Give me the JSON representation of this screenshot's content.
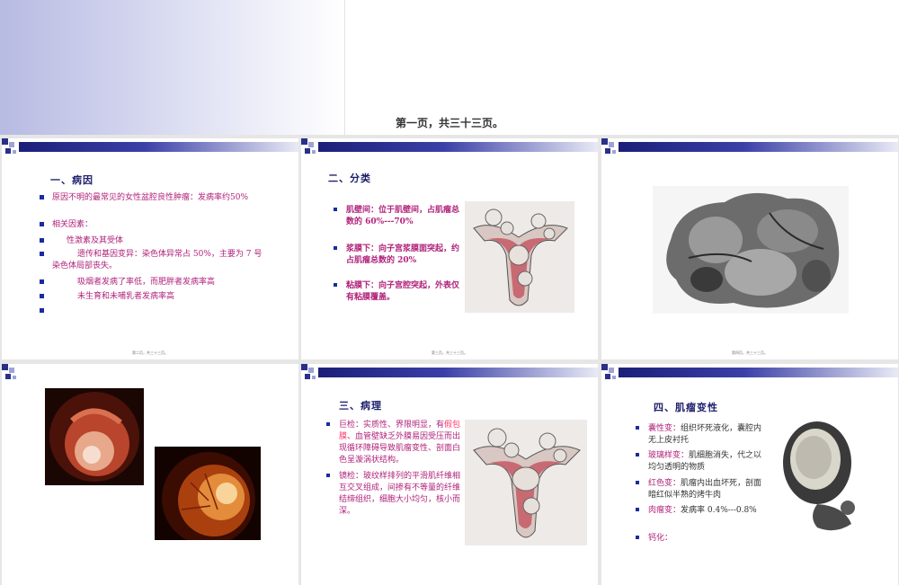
{
  "top": {
    "footer": "第一页，共三十三页。"
  },
  "slides": [
    {
      "title": "一、病因",
      "bullets": [
        "原因不明的最常见的女性盆腔良性肿瘤：发病率约50%",
        "相关因素：",
        "性激素及其受体",
        "遗传和基因变异：染色体异常占 50%，主要为 7 号染色体局部丧失。",
        "吸烟者发病了率低，而肥胖者发病率高",
        "未生育和未哺乳者发病率高",
        ""
      ],
      "footer": "第二页，共三十三页。"
    },
    {
      "title": "二、分类",
      "bullets": [
        "肌壁间：位于肌壁间，占肌瘤总数的 60%---70%",
        "浆膜下：向子宫浆膜面突起，约占肌瘤总数的 20%",
        "粘膜下：向子宫腔突起，外表仅有粘膜覆盖。"
      ],
      "footer": "第三页，共三十三页。"
    },
    {
      "footer": "第四页，共三十三页。"
    },
    {
      "footer": ""
    },
    {
      "title": "三、病理",
      "bullets": [
        {
          "pre": "巨检：实质性、界限明显，有",
          "hl": "假包膜",
          "post": "、血管壁缺乏外膜易因受压而出现循环障碍导致肌瘤变性、剖面白色呈漩涡状结构。"
        },
        {
          "pre": "镜检：玻纹样排列的平滑肌纤维相互交叉组成，间掺有不等量的纤维结缔组织，细胞大小均匀，核小而深。",
          "hl": "",
          "post": ""
        }
      ],
      "footer": ""
    },
    {
      "title": "四、肌瘤变性",
      "bullets": [
        {
          "lead": "囊性变：",
          "text": "组织坏死液化，囊腔内无上皮衬托"
        },
        {
          "lead": "玻璃样变：",
          "text": "肌细胞消失，代之以均匀透明的物质"
        },
        {
          "lead": "红色变：",
          "text": "肌瘤内出血坏死，剖面暗红似半熟的烤牛肉"
        },
        {
          "lead": "肉瘤变：",
          "text": "发病率 0.4%---0.8%"
        },
        {
          "lead": "钙化：",
          "text": ""
        }
      ],
      "footer": ""
    }
  ],
  "colors": {
    "accent": "#1b1f78",
    "text_pink": "#b0227a",
    "title": "#1d1f6b"
  }
}
